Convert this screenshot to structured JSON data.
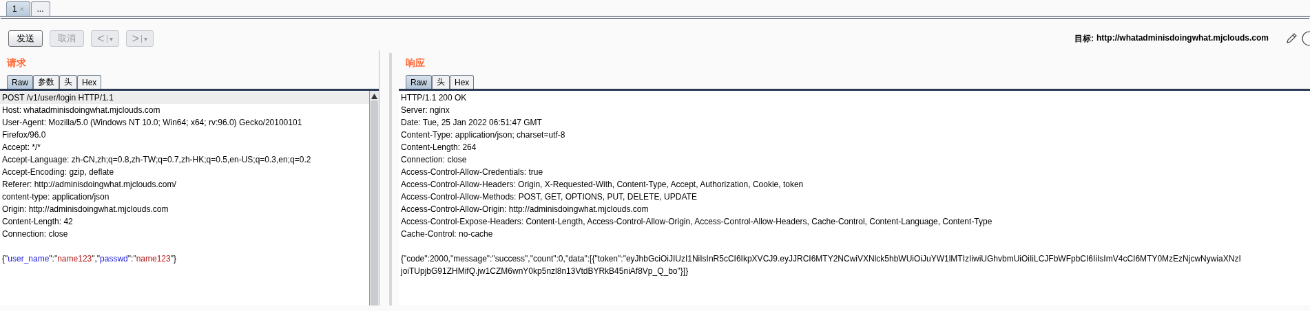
{
  "top_tabs": [
    {
      "label": "1",
      "close": "×",
      "selected": true
    },
    {
      "label": "...",
      "selected": false
    }
  ],
  "toolbar": {
    "buttons": [
      {
        "kind": "text",
        "label": "发送",
        "disabled": false
      },
      {
        "kind": "text",
        "label": "取消",
        "disabled": true
      },
      {
        "kind": "nav",
        "label": "<",
        "caret": "▾",
        "disabled": true
      },
      {
        "kind": "nav",
        "label": ">",
        "caret": "▾",
        "disabled": true
      }
    ],
    "target_label": "目标:",
    "target_url": "http://whatadminisdoingwhat.mjclouds.com"
  },
  "request": {
    "title": "请求",
    "tabs": [
      {
        "label": "Raw",
        "selected": true
      },
      {
        "label": "参数",
        "selected": false
      },
      {
        "label": "头",
        "selected": false
      },
      {
        "label": "Hex",
        "selected": false
      }
    ],
    "lines": [
      {
        "text": "POST /v1/user/login HTTP/1.1",
        "selected": true
      },
      {
        "text": "Host: whatadminisdoingwhat.mjclouds.com",
        "selected": false
      },
      {
        "text": "User-Agent: Mozilla/5.0 (Windows NT 10.0; Win64; x64; rv:96.0) Gecko/20100101",
        "selected": false
      },
      {
        "text": "Firefox/96.0",
        "selected": false
      },
      {
        "text": "Accept: */*",
        "selected": false
      },
      {
        "text": "Accept-Language: zh-CN,zh;q=0.8,zh-TW;q=0.7,zh-HK;q=0.5,en-US;q=0.3,en;q=0.2",
        "selected": false
      },
      {
        "text": "Accept-Encoding: gzip, deflate",
        "selected": false
      },
      {
        "text": "Referer: http://adminisdoingwhat.mjclouds.com/",
        "selected": false
      },
      {
        "text": "content-type: application/json",
        "selected": false
      },
      {
        "text": "Origin: http://adminisdoingwhat.mjclouds.com",
        "selected": false
      },
      {
        "text": "Content-Length: 42",
        "selected": false
      },
      {
        "text": "Connection: close",
        "selected": false
      }
    ],
    "body": [
      {
        "kind": "punct",
        "text": "{\""
      },
      {
        "kind": "key",
        "text": "user_name"
      },
      {
        "kind": "punct",
        "text": "\":\""
      },
      {
        "kind": "value",
        "text": "name123"
      },
      {
        "kind": "punct",
        "text": "\",\""
      },
      {
        "kind": "key",
        "text": "passwd"
      },
      {
        "kind": "punct",
        "text": "\":\""
      },
      {
        "kind": "value",
        "text": "name123"
      },
      {
        "kind": "punct",
        "text": "\"}"
      }
    ]
  },
  "response": {
    "title": "响应",
    "tabs": [
      {
        "label": "Raw",
        "selected": true
      },
      {
        "label": "头",
        "selected": false
      },
      {
        "label": "Hex",
        "selected": false
      }
    ],
    "lines": [
      "HTTP/1.1 200 OK",
      "Server: nginx",
      "Date: Tue, 25 Jan 2022 06:51:47 GMT",
      "Content-Type: application/json; charset=utf-8",
      "Content-Length: 264",
      "Connection: close",
      "Access-Control-Allow-Credentials: true",
      "Access-Control-Allow-Headers: Origin, X-Requested-With, Content-Type, Accept, Authorization, Cookie, token",
      "Access-Control-Allow-Methods: POST, GET, OPTIONS, PUT, DELETE, UPDATE",
      "Access-Control-Allow-Origin: http://adminisdoingwhat.mjclouds.com",
      "Access-Control-Expose-Headers: Content-Length, Access-Control-Allow-Origin, Access-Control-Allow-Headers, Cache-Control, Content-Language, Content-Type",
      "Cache-Control: no-cache"
    ],
    "body": [
      "{\"code\":2000,\"message\":\"success\",\"count\":0,\"data\":[{\"token\":\"eyJhbGciOiJIUzI1NiIsInR5cCI6IkpXVCJ9.eyJJRCI6MTY2NCwiVXNlck5hbWUiOiJuYW1lMTIzIiwiUGhvbmUiOiIiLCJFbWFpbCI6IiIsImV4cCI6MTY0MzEzNjcwNywiaXNzI",
      "joiTUpjbG91ZHMifQ.jw1CZM6wnY0kp5nzl8n13VtdBYRkB45niAf8Vp_Q_bo\"}]}"
    ]
  }
}
